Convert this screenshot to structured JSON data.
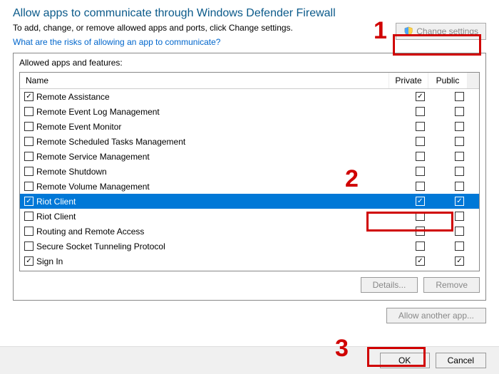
{
  "header": {
    "title": "Allow apps to communicate through Windows Defender Firewall",
    "subtitle": "To add, change, or remove allowed apps and ports, click Change settings.",
    "risk_link": "What are the risks of allowing an app to communicate?",
    "change_settings": "Change settings"
  },
  "section": {
    "label": "Allowed apps and features:",
    "col_name": "Name",
    "col_private": "Private",
    "col_public": "Public"
  },
  "rows": [
    {
      "name": "Remote Assistance",
      "name_checked": true,
      "private": true,
      "public": false,
      "selected": false
    },
    {
      "name": "Remote Event Log Management",
      "name_checked": false,
      "private": false,
      "public": false,
      "selected": false
    },
    {
      "name": "Remote Event Monitor",
      "name_checked": false,
      "private": false,
      "public": false,
      "selected": false
    },
    {
      "name": "Remote Scheduled Tasks Management",
      "name_checked": false,
      "private": false,
      "public": false,
      "selected": false
    },
    {
      "name": "Remote Service Management",
      "name_checked": false,
      "private": false,
      "public": false,
      "selected": false
    },
    {
      "name": "Remote Shutdown",
      "name_checked": false,
      "private": false,
      "public": false,
      "selected": false
    },
    {
      "name": "Remote Volume Management",
      "name_checked": false,
      "private": false,
      "public": false,
      "selected": false
    },
    {
      "name": "Riot Client",
      "name_checked": true,
      "private": true,
      "public": true,
      "selected": true
    },
    {
      "name": "Riot Client",
      "name_checked": false,
      "private": false,
      "public": false,
      "selected": false
    },
    {
      "name": "Routing and Remote Access",
      "name_checked": false,
      "private": false,
      "public": false,
      "selected": false
    },
    {
      "name": "Secure Socket Tunneling Protocol",
      "name_checked": false,
      "private": false,
      "public": false,
      "selected": false
    },
    {
      "name": "Sign In",
      "name_checked": true,
      "private": true,
      "public": true,
      "selected": false
    }
  ],
  "buttons": {
    "details": "Details...",
    "remove": "Remove",
    "allow_another": "Allow another app...",
    "ok": "OK",
    "cancel": "Cancel"
  },
  "annotations": {
    "n1": "1",
    "n2": "2",
    "n3": "3"
  }
}
